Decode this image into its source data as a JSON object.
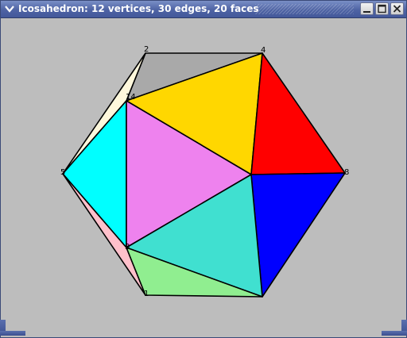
{
  "window": {
    "title": "Icosahedron: 12 vertices, 30 edges, 20 faces",
    "menu_icon": "chevron-down-icon",
    "buttons": [
      "minimize-icon",
      "maximize-icon",
      "close-icon"
    ]
  },
  "colors": {
    "titlebar": "#4e63a4",
    "canvas_background": "#bdbdbd",
    "edge": "#000000"
  },
  "vertex_labels": {
    "v2": "2",
    "v4": "4",
    "v14": "14",
    "v5": "5",
    "v8": "8",
    "v3": "3",
    "v1": "1"
  },
  "face_colors": [
    "gray",
    "gold",
    "red",
    "cornsilk",
    "cyan",
    "violet",
    "turquoise",
    "blue",
    "pink",
    "light-green"
  ]
}
